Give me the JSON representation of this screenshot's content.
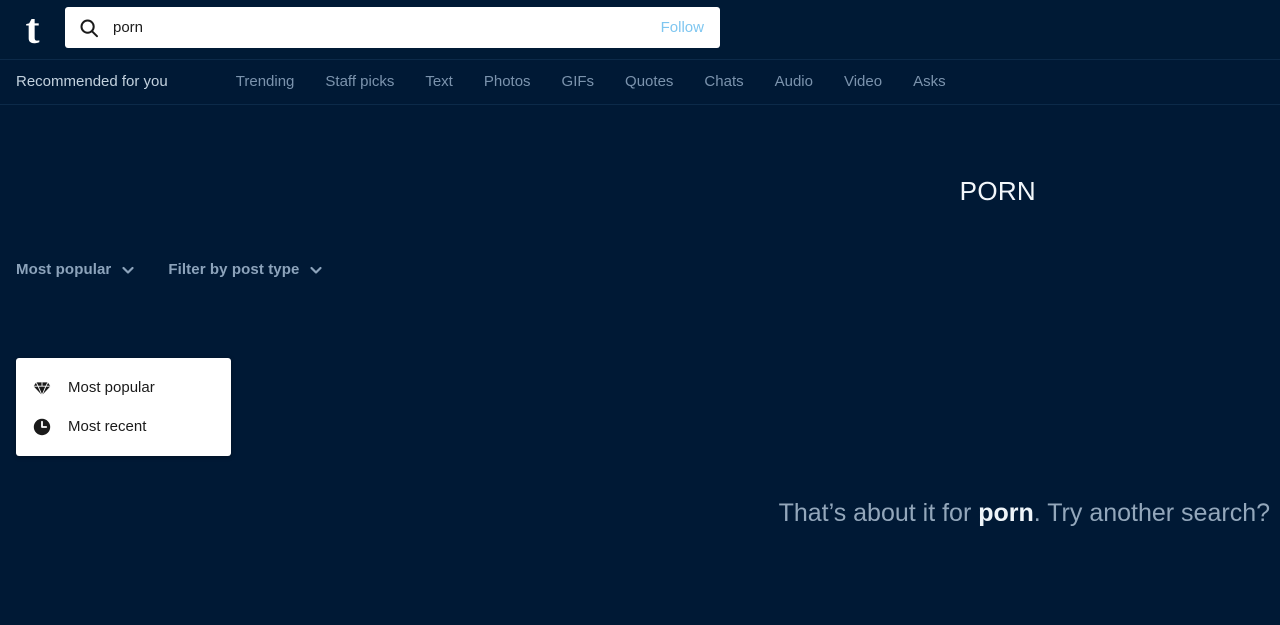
{
  "header": {
    "logo_glyph": "t",
    "logo_name": "tumblr-logo",
    "search": {
      "value": "porn",
      "placeholder": "Search",
      "icon": "search-icon"
    },
    "follow_label": "Follow"
  },
  "nav": {
    "items": [
      {
        "label": "Recommended for you",
        "primary": true
      },
      {
        "label": "Trending",
        "primary": false
      },
      {
        "label": "Staff picks",
        "primary": false
      },
      {
        "label": "Text",
        "primary": false
      },
      {
        "label": "Photos",
        "primary": false
      },
      {
        "label": "GIFs",
        "primary": false
      },
      {
        "label": "Quotes",
        "primary": false
      },
      {
        "label": "Chats",
        "primary": false
      },
      {
        "label": "Audio",
        "primary": false
      },
      {
        "label": "Video",
        "primary": false
      },
      {
        "label": "Asks",
        "primary": false
      }
    ]
  },
  "content": {
    "tag_title": "PORN",
    "filters": [
      {
        "label": "Most popular",
        "icon": "chevron-down-icon"
      },
      {
        "label": "Filter by post type",
        "icon": "chevron-down-icon"
      }
    ],
    "sort_dropdown": {
      "open": true,
      "options": [
        {
          "label": "Most popular",
          "icon": "diamond-icon"
        },
        {
          "label": "Most recent",
          "icon": "clock-icon"
        }
      ]
    },
    "empty_state": {
      "prefix": "That’s about it for ",
      "term": "porn",
      "suffix": ". Try another search?"
    }
  },
  "colors": {
    "page_bg": "#001935",
    "header_bg": "#001a35",
    "nav_border": "#0c2a49",
    "nav_text": "#7b93ad",
    "nav_text_active": "#c2d1de",
    "follow_link": "#7ec6f0",
    "filter_text": "#8ca3bb",
    "empty_text": "#93a7bb",
    "dropdown_bg": "#ffffff",
    "dropdown_text": "#1a1a1a",
    "title_text": "#f2f7fb"
  }
}
